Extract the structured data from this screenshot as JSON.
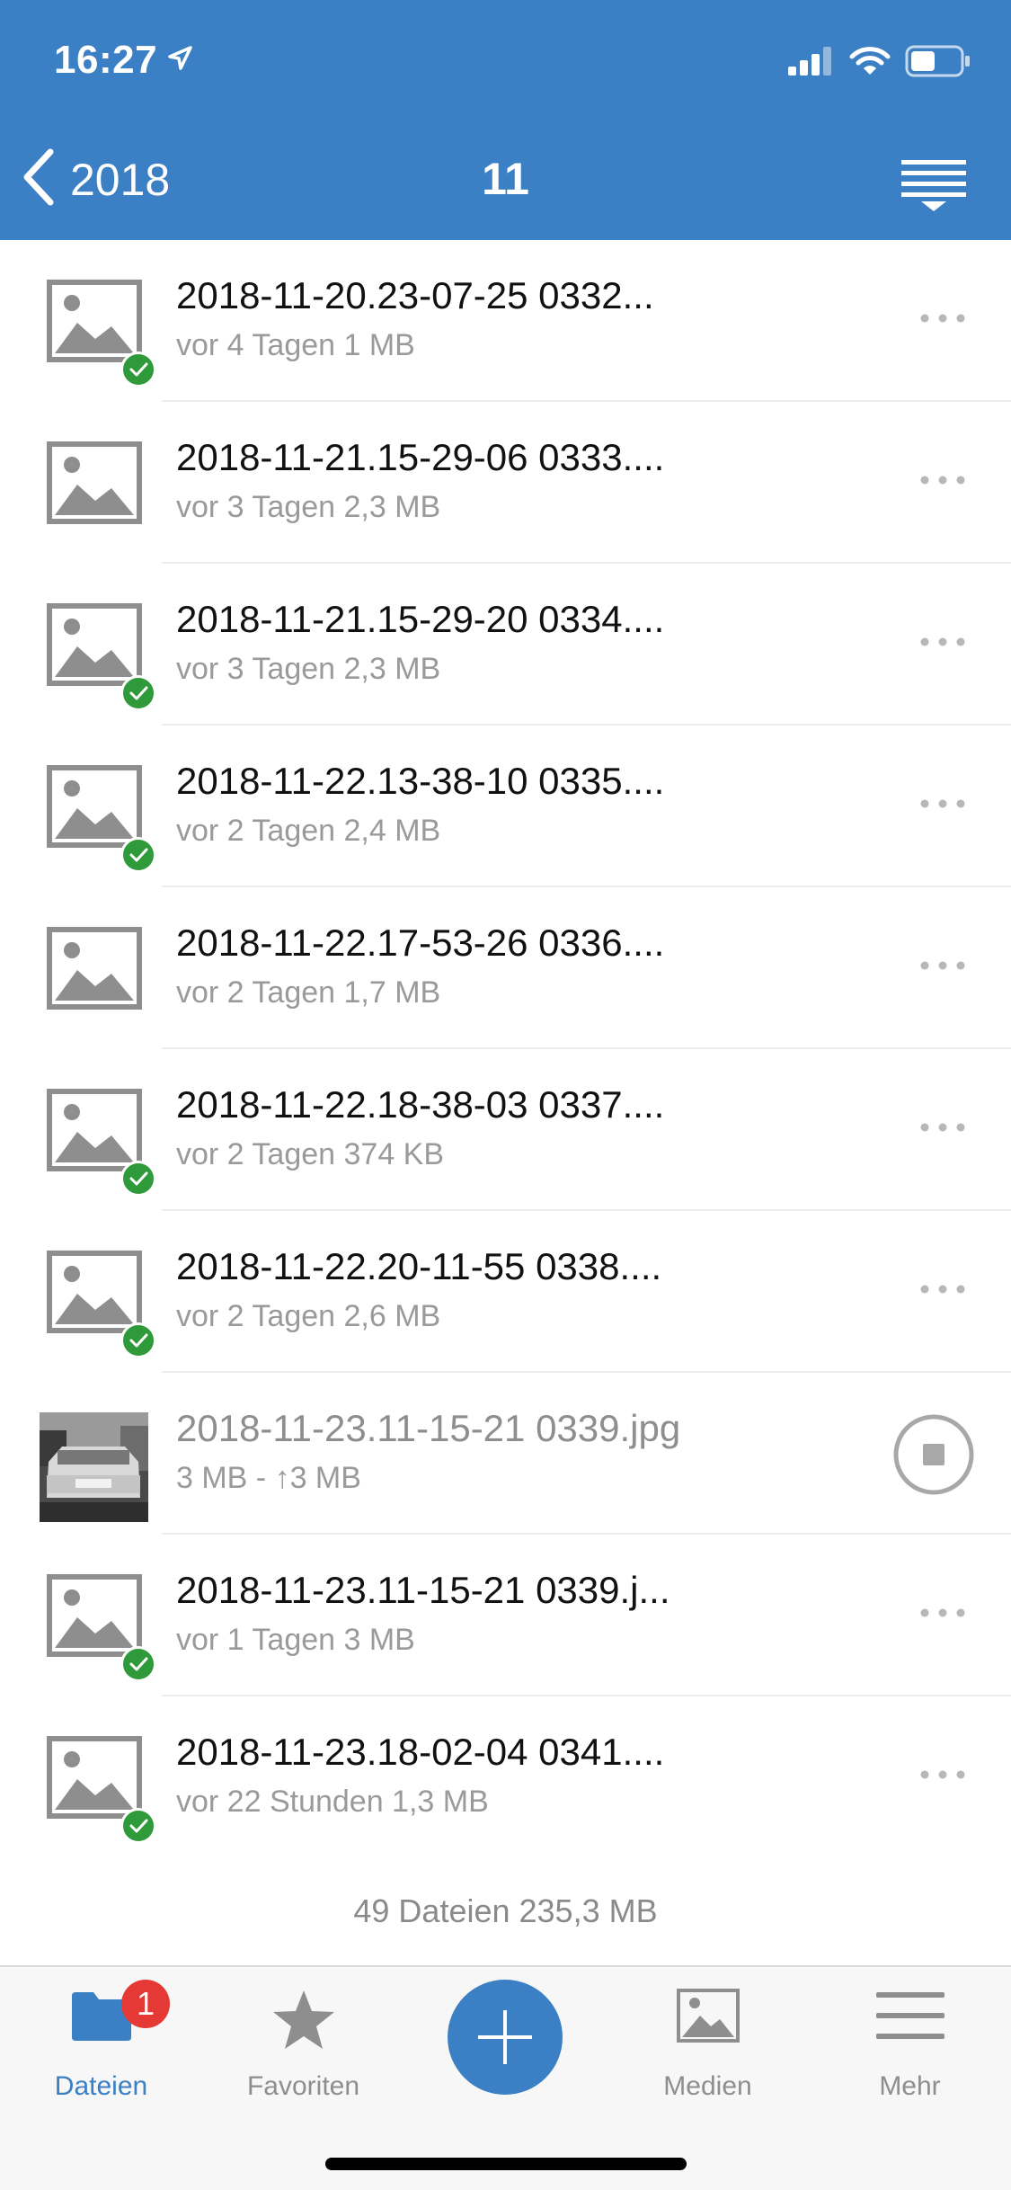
{
  "status_bar": {
    "time": "16:27"
  },
  "nav": {
    "back_label": "2018",
    "title": "11"
  },
  "files": [
    {
      "name": "2018-11-20.23-07-25 0332...",
      "meta": "vor 4 Tagen 1 MB",
      "synced": true
    },
    {
      "name": "2018-11-21.15-29-06 0333....",
      "meta": "vor 3 Tagen 2,3 MB",
      "synced": false
    },
    {
      "name": "2018-11-21.15-29-20 0334....",
      "meta": "vor 3 Tagen 2,3 MB",
      "synced": true
    },
    {
      "name": "2018-11-22.13-38-10 0335....",
      "meta": "vor 2 Tagen 2,4 MB",
      "synced": true
    },
    {
      "name": "2018-11-22.17-53-26 0336....",
      "meta": "vor 2 Tagen 1,7 MB",
      "synced": false
    },
    {
      "name": "2018-11-22.18-38-03 0337....",
      "meta": "vor 2 Tagen 374 KB",
      "synced": true
    },
    {
      "name": "2018-11-22.20-11-55 0338....",
      "meta": "vor 2 Tagen 2,6 MB",
      "synced": true
    },
    {
      "name": "2018-11-23.11-15-21 0339.jpg",
      "meta": "3 MB - ↑3 MB",
      "uploading": true
    },
    {
      "name": "2018-11-23.11-15-21 0339.j...",
      "meta": "vor 1 Tagen 3 MB",
      "synced": true
    },
    {
      "name": "2018-11-23.18-02-04 0341....",
      "meta": "vor 22 Stunden 1,3 MB",
      "synced": true
    }
  ],
  "summary": "49 Dateien 235,3 MB",
  "tabs": {
    "files": {
      "label": "Dateien",
      "badge": "1"
    },
    "favorites": {
      "label": "Favoriten"
    },
    "media": {
      "label": "Medien"
    },
    "more": {
      "label": "Mehr"
    }
  },
  "colors": {
    "accent": "#3b7fc4",
    "synced": "#2e9a3a",
    "badge": "#e53935"
  }
}
